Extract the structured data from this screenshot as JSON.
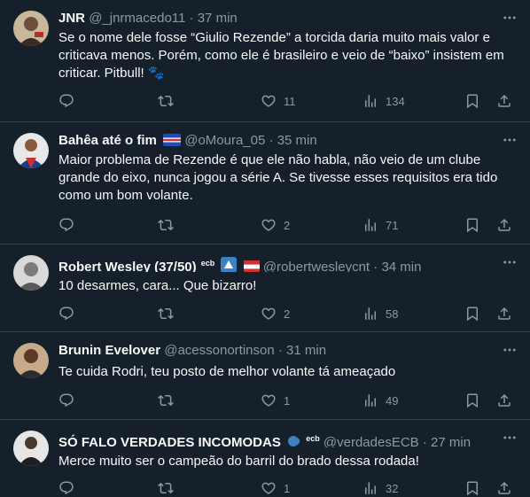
{
  "colors": {
    "background": "#15202b",
    "text": "#f7f9f9",
    "muted": "#8b98a5",
    "divider": "#38444d"
  },
  "tweets": [
    {
      "name": "JNR",
      "handle": "@_jnrmacedo11",
      "time": "37 min",
      "lines": [
        "Se o nome dele fosse “Giulio Rezende” a torcida daria muito mais valor e",
        "criticava menos. Porém, como ele é brasileiro e veio de “baixo” insistem em",
        "criticar. Pitbull! 🐾"
      ],
      "likes": "11",
      "views": "134"
    },
    {
      "name": "Bahêa até o fim",
      "handle": "@oMoura_05",
      "time": "35 min",
      "lines": [
        "Maior problema de Rezende é que ele não habla, não veio de um clube",
        "grande do eixo, nunca jogou a série A. Se tivesse esses requisitos era tido",
        "como um bom volante."
      ],
      "likes": "2",
      "views": "71"
    },
    {
      "name": "Robert Wesley (37/50)",
      "badge": "ecb",
      "handle": "@robertwesleycnt",
      "time": "34 min",
      "lines": [
        "10 desarmes, cara... Que bizarro!"
      ],
      "likes": "2",
      "views": "58"
    },
    {
      "name": "Brunin Evelover",
      "handle": "@acessonortinson",
      "time": "31 min",
      "lines": [
        "Te cuida Rodri, teu posto de melhor volante tá ameaçado"
      ],
      "likes": "1",
      "views": "49"
    },
    {
      "name": "SÓ FALO VERDADES INCOMODAS",
      "badge": "ecb",
      "handle": "@verdadesECB",
      "time": "27 min",
      "lines": [
        "Merce muito ser o campeão do barril do brado dessa rodada!"
      ],
      "likes": "1",
      "views": "32"
    }
  ]
}
